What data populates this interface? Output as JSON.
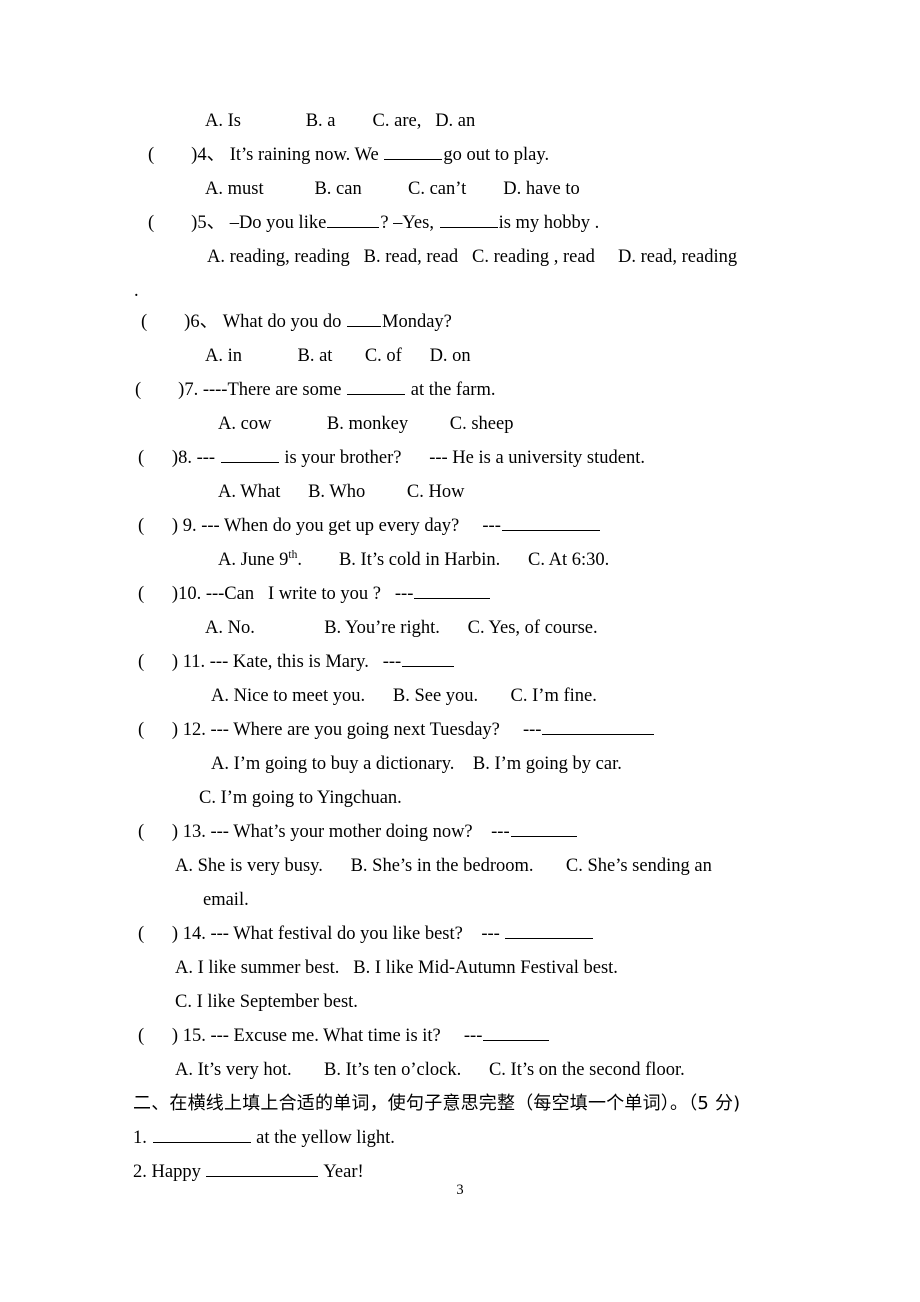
{
  "document": {
    "page_number": "3",
    "stray_period": "."
  },
  "lines": {
    "q3_options": "A. Is              B. a        C. are,   D. an",
    "q4_stem_a": "(        )4、 It’s raining now. We ",
    "q4_stem_b": "go out to play.",
    "q4_options": "A. must           B. can          C. can’t        D. have to",
    "q5_stem_a": "(        )5、 –Do you like",
    "q5_stem_b": "? –Yes, ",
    "q5_stem_c": "is my hobby .",
    "q5_options": "A. reading, reading   B. read, read   C. reading , read     D. read, reading",
    "q6_stem_a": "(        )6、 What do you do ",
    "q6_stem_b": "Monday?",
    "q6_options": "A. in            B. at       C. of      D. on",
    "q7_stem_a": "(        )7. ----There are some ",
    "q7_stem_b": " at the farm.",
    "q7_options": "A. cow            B. monkey         C. sheep",
    "q8_stem_a": "(      )8. --- ",
    "q8_stem_b": " is your brother?      --- He is a university student.",
    "q8_options": "A. What      B. Who         C. How",
    "q9_stem_a": "(      ) 9. --- When do you get up every day?     ---",
    "q9_opt_a_pre": "A. June 9",
    "q9_opt_a_sup": "th",
    "q9_opt_rest": ".        B. It’s cold in Harbin.      C. At 6:30.",
    "q10_stem_a": "(      )10. ---Can   I write to you ?   ---",
    "q10_options": "A. No.               B. You’re right.      C. Yes, of course.",
    "q11_stem_a": "(      ) 11. --- Kate, this is Mary.   ---",
    "q11_options": "A. Nice to meet you.      B. See you.       C. I’m fine.",
    "q12_stem_a": "(      ) 12. --- Where are you going next Tuesday?     ---",
    "q12_options_ab": "A. I’m going to buy a dictionary.    B. I’m going by car.",
    "q12_option_c": "C. I’m going to Yingchuan.",
    "q13_stem_a": "(      ) 13. --- What’s your mother doing now?    ---",
    "q13_options_abc": "A. She is very busy.      B. She’s in the bedroom.       C. She’s sending an",
    "q13_option_cont": "email.",
    "q14_stem_a": "(      ) 14. --- What festival do you like best?    --- ",
    "q14_options_ab": "A. I like summer best.   B. I like Mid-Autumn Festival best.",
    "q14_option_c": "C. I like September best.",
    "q15_stem_a": "(      ) 15. --- Excuse me. What time is it?     ---",
    "q15_options": "A. It’s very hot.       B. It’s ten o’clock.      C. It’s on the second floor.",
    "section2_heading": "二、在横线上填上合适的单词，使句子意思完整（每空填一个单词）。（5 分)",
    "fill1_pre": "1. ",
    "fill1_post": " at the yellow light.",
    "fill2_pre": "2. Happy ",
    "fill2_post": " Year!"
  }
}
